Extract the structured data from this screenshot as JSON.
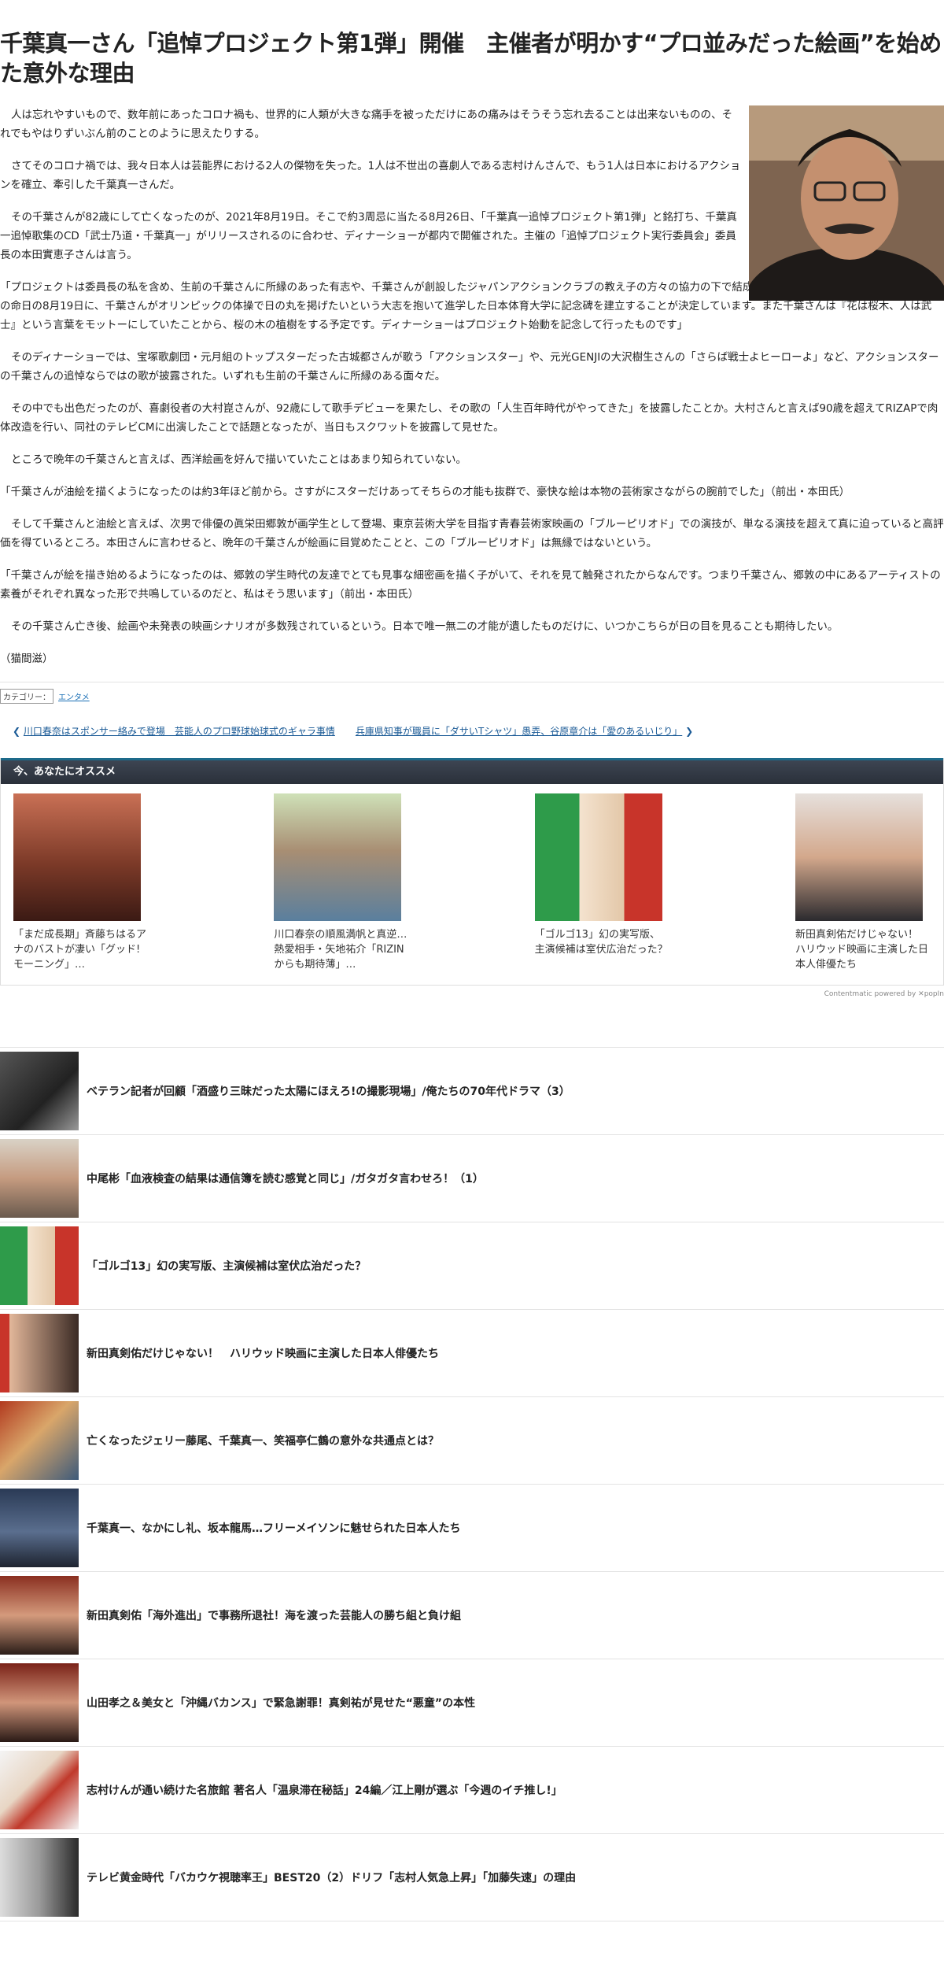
{
  "article": {
    "title": "千葉真一さん「追悼プロジェクト第1弾」開催　主催者が明かす“プロ並みだった絵画”を始めた意外な理由",
    "paragraphs": [
      "人は忘れやすいもので、数年前にあったコロナ禍も、世界的に人類が大きな痛手を被っただけにあの痛みはそうそう忘れ去ることは出来ないものの、それでもやはりずいぶん前のことのように思えたりする。",
      "さてそのコロナ禍では、我々日本人は芸能界における2人の傑物を失った。1人は不世出の喜劇人である志村けんさんで、もう1人は日本におけるアクションを確立、牽引した千葉真一さんだ。",
      "その千葉さんが82歳にして亡くなったのが、2021年8月19日。そこで約3周忌に当たる8月26日、「千葉真一追悼プロジェクト第1弾」と銘打ち、千葉真一追悼歌集のCD「武士乃道・千葉真一」がリリースされるのに合わせ、ディナーショーが都内で開催された。主催の「追悼プロジェクト実行委員会」委員長の本田實恵子さんは言う。",
      "「プロジェクトは委員長の私を含め、生前の千葉さんに所縁のあった有志や、千葉さんが創設したジャパンアクションクラブの教え子の方々の協力の下で結成されました。今後の活動としては、来年の命日の8月19日に、千葉さんがオリンピックの体操で日の丸を掲げたいという大志を抱いて進学した日本体育大学に記念碑を建立することが決定しています。また千葉さんは『花は桜木、人は武士』という言葉をモットーにしていたことから、桜の木の植樹をする予定です。ディナーショーはプロジェクト始動を記念して行ったものです」",
      "そのディナーショーでは、宝塚歌劇団・元月組のトップスターだった古城都さんが歌う「アクションスター」や、元光GENJIの大沢樹生さんの「さらば戦士よヒーローよ」など、アクションスターの千葉さんの追悼ならではの歌が披露された。いずれも生前の千葉さんに所縁のある面々だ。",
      "その中でも出色だったのが、喜劇役者の大村崑さんが、92歳にして歌手デビューを果たし、その歌の「人生百年時代がやってきた」を披露したことか。大村さんと言えば90歳を超えてRIZAPで肉体改造を行い、同社のテレビCMに出演したことで話題となったが、当日もスクワットを披露して見せた。",
      "ところで晩年の千葉さんと言えば、西洋絵画を好んで描いていたことはあまり知られていない。",
      "「千葉さんが油絵を描くようになったのは約3年ほど前から。さすがにスターだけあってそちらの才能も抜群で、豪快な絵は本物の芸術家さながらの腕前でした」（前出・本田氏）",
      "そして千葉さんと油絵と言えば、次男で俳優の眞栄田郷敦が画学生として登場、東京芸術大学を目指す青春芸術家映画の「ブルーピリオド」での演技が、単なる演技を超えて真に迫っていると高評価を得ているところ。本田さんに言わせると、晩年の千葉さんが絵画に目覚めたことと、この「ブルーピリオド」は無縁ではないという。",
      "「千葉さんが絵を描き始めるようになったのは、郷敦の学生時代の友達でとても見事な細密画を描く子がいて、それを見て触発されたからなんです。つまり千葉さん、郷敦の中にあるアーティストの素養がそれぞれ異なった形で共鳴しているのだと、私はそう思います」（前出・本田氏）",
      "その千葉さん亡き後、絵画や未発表の映画シナリオが多数残されているという。日本で唯一無二の才能が遺したものだけに、いつかこちらが日の目を見ることも期待したい。",
      "（猫間滋）"
    ],
    "category_label": "カテゴリー：",
    "category_link": "エンタメ"
  },
  "nav": {
    "prev": "川口春奈はスポンサー絡みで登場　芸能人のプロ野球始球式のギャラ事情",
    "next": "兵庫県知事が職員に「ダサいTシャツ」愚弄、谷原章介は「愛のあるいじり」"
  },
  "recommend": {
    "heading": "今、あなたにオススメ",
    "items": [
      {
        "caption": "「まだ成長期」斉藤ちはるアナのバストが凄い「グッド!モーニング」…"
      },
      {
        "caption": "川口春奈の順風満帆と真逆…熱愛相手・矢地祐介「RIZINからも期待薄」…"
      },
      {
        "caption": "「ゴルゴ13」幻の実写版、主演候補は室伏広治だった？"
      },
      {
        "caption": "新田真剣佑だけじゃない！　ハリウッド映画に主演した日本人俳優たち"
      }
    ],
    "powered": "Contentmatic powered by ✕popIn"
  },
  "related": [
    {
      "title": "ベテラン記者が回顧「酒盛り三昧だった太陽にほえろ!の撮影現場」/俺たちの70年代ドラマ（3）"
    },
    {
      "title": "中尾彬「血液検査の結果は通信簿を読む感覚と同じ」/ガタガタ言わせろ！（1）"
    },
    {
      "title": "「ゴルゴ13」幻の実写版、主演候補は室伏広治だった？"
    },
    {
      "title": "新田真剣佑だけじゃない！　ハリウッド映画に主演した日本人俳優たち"
    },
    {
      "title": "亡くなったジェリー藤尾、千葉真一、笑福亭仁鶴の意外な共通点とは？"
    },
    {
      "title": "千葉真一、なかにし礼、坂本龍馬…フリーメイソンに魅せられた日本人たち"
    },
    {
      "title": "新田真剣佑「海外進出」で事務所退社！海を渡った芸能人の勝ち組と負け組"
    },
    {
      "title": "山田孝之＆美女と「沖縄バカンス」で緊急謝罪！真剣祐が見せた“悪童”の本性"
    },
    {
      "title": "志村けんが通い続けた名旅館 著名人「温泉滞在秘話」24編／江上剛が選ぶ「今週のイチ推し!」"
    },
    {
      "title": "テレビ黄金時代「バカウケ視聴率王」BEST20（2）ドリフ「志村人気急上昇」「加藤失速」の理由"
    }
  ]
}
